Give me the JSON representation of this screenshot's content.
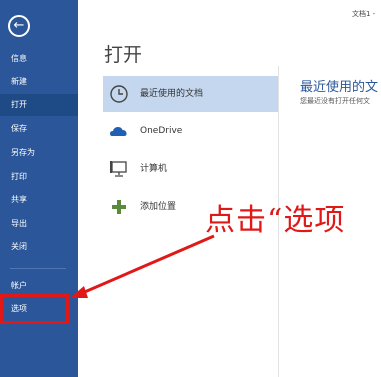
{
  "nav": {
    "back_icon": "arrow-left-icon",
    "items": [
      {
        "label": "信息"
      },
      {
        "label": "新建"
      },
      {
        "label": "打开"
      },
      {
        "label": "保存"
      },
      {
        "label": "另存为"
      },
      {
        "label": "打印"
      },
      {
        "label": "共享"
      },
      {
        "label": "导出"
      },
      {
        "label": "关闭"
      },
      {
        "label": "帐户"
      },
      {
        "label": "选项"
      }
    ],
    "active_item": "打开",
    "highlighted_item": "选项"
  },
  "window": {
    "doc_title": "文档1 - "
  },
  "main": {
    "title": "打开",
    "places": [
      {
        "label": "最近使用的文档",
        "icon": "clock-icon",
        "selected": true
      },
      {
        "label": "OneDrive",
        "icon": "cloud-icon",
        "selected": false
      },
      {
        "label": "计算机",
        "icon": "computer-icon",
        "selected": false
      },
      {
        "label": "添加位置",
        "icon": "plus-icon",
        "selected": false
      }
    ],
    "recent": {
      "title": "最近使用的文",
      "empty_text": "您最近没有打开任何文"
    }
  },
  "annotation": {
    "text": "点击“选项"
  },
  "colors": {
    "nav_bg": "#2b579a",
    "nav_active": "#1e4a85",
    "place_selected": "#c5d7ef",
    "annotation_red": "#e01818"
  }
}
